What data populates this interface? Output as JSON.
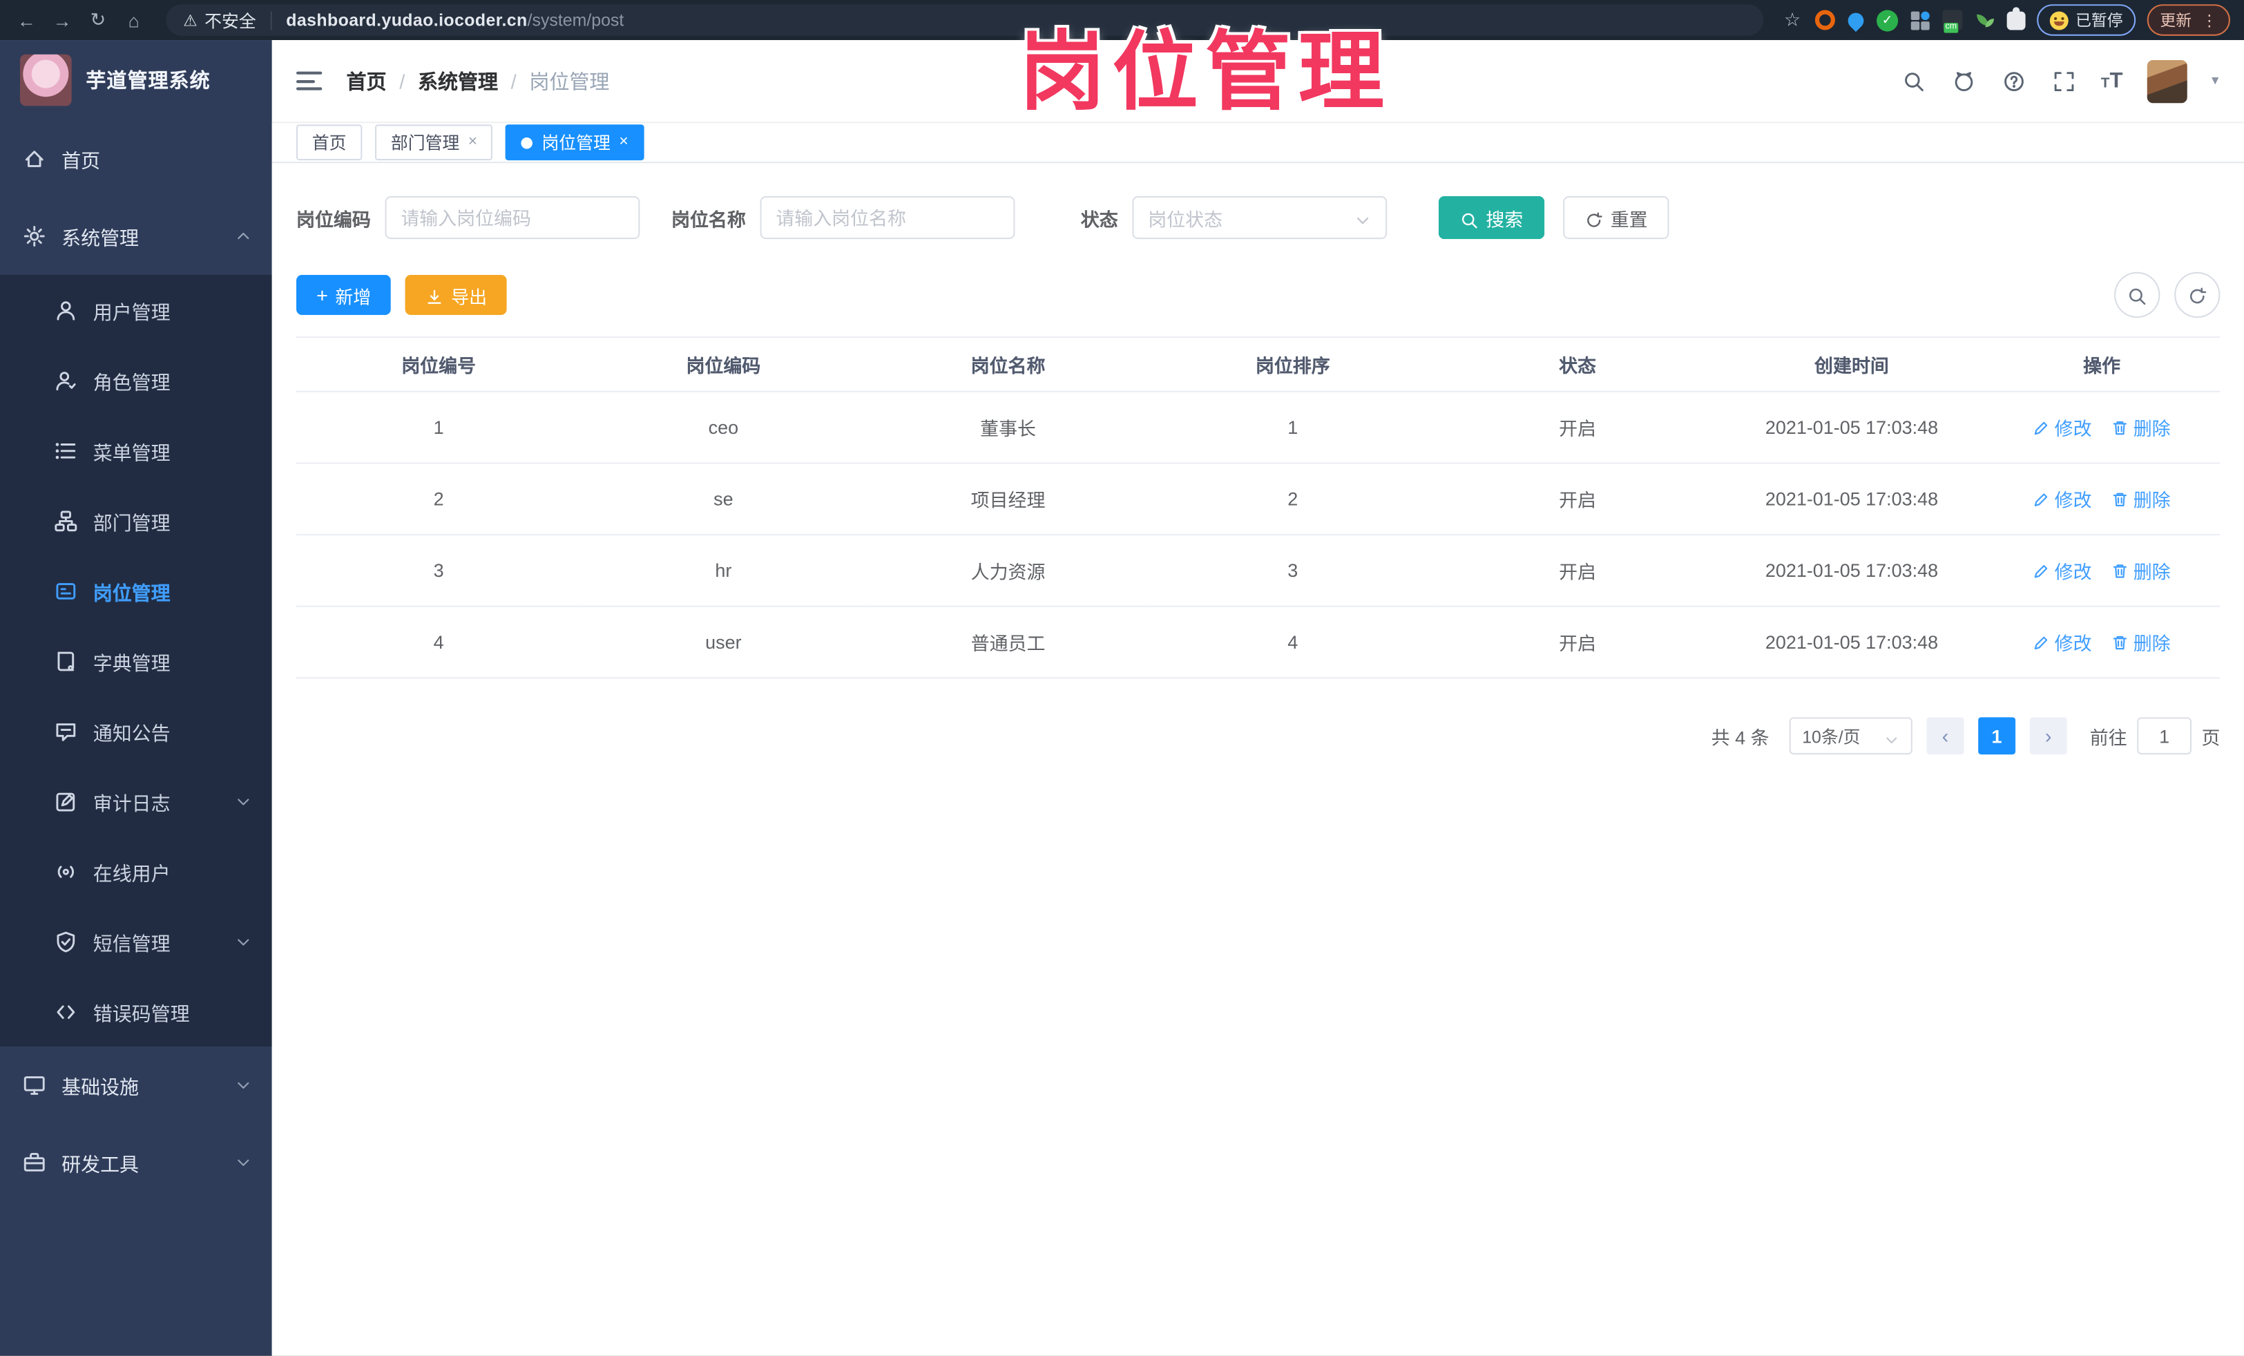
{
  "browser": {
    "security_label": "不安全",
    "url_host": "dashboard.yudao.iocoder.cn",
    "url_path": "/system/post",
    "paused_badge": "已暂停",
    "update_button": "更新",
    "icons": [
      "back-icon",
      "forward-icon",
      "reload-icon",
      "home-icon",
      "warning-icon",
      "bookmark-star-icon",
      "emoji-face-icon",
      "kebab-menu-icon"
    ]
  },
  "watermark": "岗位管理",
  "sidebar": {
    "app_title": "芋道管理系统",
    "sections": [
      {
        "id": "top",
        "items": [
          {
            "id": "home",
            "label": "首页",
            "icon": "home"
          },
          {
            "id": "system",
            "label": "系统管理",
            "icon": "gear",
            "arrow": "up"
          }
        ]
      },
      {
        "id": "sub",
        "items": [
          {
            "id": "users",
            "label": "用户管理",
            "icon": "user"
          },
          {
            "id": "roles",
            "label": "角色管理",
            "icon": "role"
          },
          {
            "id": "menus",
            "label": "菜单管理",
            "icon": "menu"
          },
          {
            "id": "depts",
            "label": "部门管理",
            "icon": "dept"
          },
          {
            "id": "posts",
            "label": "岗位管理",
            "icon": "post",
            "active": true
          },
          {
            "id": "dict",
            "label": "字典管理",
            "icon": "dict"
          },
          {
            "id": "notice",
            "label": "通知公告",
            "icon": "notice"
          },
          {
            "id": "audit",
            "label": "审计日志",
            "icon": "audit",
            "arrow": "down"
          },
          {
            "id": "online",
            "label": "在线用户",
            "icon": "online"
          },
          {
            "id": "sms",
            "label": "短信管理",
            "icon": "sms",
            "arrow": "down"
          },
          {
            "id": "errcode",
            "label": "错误码管理",
            "icon": "code"
          }
        ]
      },
      {
        "id": "bottom",
        "items": [
          {
            "id": "infra",
            "label": "基础设施",
            "icon": "infra",
            "arrow": "down"
          },
          {
            "id": "devtools",
            "label": "研发工具",
            "icon": "devtools",
            "arrow": "down"
          }
        ]
      }
    ]
  },
  "navbar": {
    "breadcrumb": [
      "首页",
      "系统管理",
      "岗位管理"
    ],
    "icons": [
      "search-icon",
      "github-icon",
      "help-icon",
      "fullscreen-icon",
      "font-size-icon",
      "avatar",
      "caret-down-icon"
    ]
  },
  "tabs": [
    {
      "label": "首页",
      "active": false,
      "closable": false
    },
    {
      "label": "部门管理",
      "active": false,
      "closable": true
    },
    {
      "label": "岗位管理",
      "active": true,
      "closable": true
    }
  ],
  "filters": {
    "code_label": "岗位编码",
    "code_placeholder": "请输入岗位编码",
    "name_label": "岗位名称",
    "name_placeholder": "请输入岗位名称",
    "status_label": "状态",
    "status_placeholder": "岗位状态",
    "search_button": "搜索",
    "reset_button": "重置"
  },
  "toolbar": {
    "add_button": "新增",
    "export_button": "导出",
    "icons": [
      "search-toggle-icon",
      "refresh-icon"
    ]
  },
  "table": {
    "columns": [
      "岗位编号",
      "岗位编码",
      "岗位名称",
      "岗位排序",
      "状态",
      "创建时间",
      "操作"
    ],
    "rows": [
      {
        "no": "1",
        "code": "ceo",
        "name": "董事长",
        "sort": "1",
        "status": "开启",
        "created": "2021-01-05 17:03:48"
      },
      {
        "no": "2",
        "code": "se",
        "name": "项目经理",
        "sort": "2",
        "status": "开启",
        "created": "2021-01-05 17:03:48"
      },
      {
        "no": "3",
        "code": "hr",
        "name": "人力资源",
        "sort": "3",
        "status": "开启",
        "created": "2021-01-05 17:03:48"
      },
      {
        "no": "4",
        "code": "user",
        "name": "普通员工",
        "sort": "4",
        "status": "开启",
        "created": "2021-01-05 17:03:48"
      }
    ],
    "edit_action": "修改",
    "delete_action": "删除"
  },
  "pagination": {
    "total": "共 4 条",
    "page_size": "10条/页",
    "current_page": "1",
    "goto_label": "前往",
    "goto_value": "1",
    "page_unit": "页"
  },
  "colors": {
    "accent_blue": "#1890ff",
    "teal_search": "#23b2a2",
    "amber_export": "#f6a623",
    "watermark_pink": "#f2385f",
    "sidebar_bg": "#2f3c59",
    "submenu_bg": "#212c42"
  }
}
